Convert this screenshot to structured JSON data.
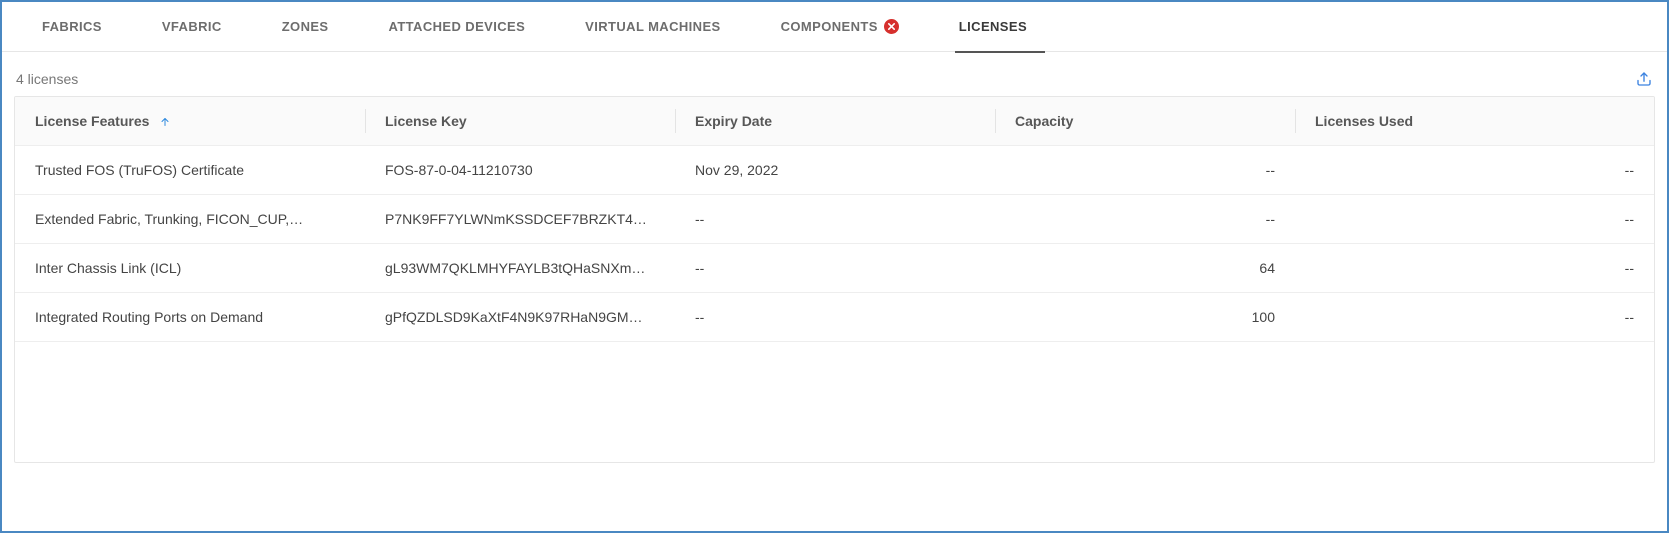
{
  "tabs": [
    {
      "label": "FABRICS",
      "selected": false,
      "status": null
    },
    {
      "label": "VFABRIC",
      "selected": false,
      "status": null
    },
    {
      "label": "ZONES",
      "selected": false,
      "status": null
    },
    {
      "label": "ATTACHED DEVICES",
      "selected": false,
      "status": null
    },
    {
      "label": "VIRTUAL MACHINES",
      "selected": false,
      "status": null
    },
    {
      "label": "COMPONENTS",
      "selected": false,
      "status": "error"
    },
    {
      "label": "LICENSES",
      "selected": true,
      "status": null
    }
  ],
  "summary": "4 licenses",
  "columns": {
    "features": "License Features",
    "key": "License Key",
    "expiry": "Expiry Date",
    "capacity": "Capacity",
    "used": "Licenses Used"
  },
  "sort": {
    "column": "features",
    "dir": "asc"
  },
  "rows": [
    {
      "features": "Trusted FOS (TruFOS) Certificate",
      "key": "FOS-87-0-04-11210730",
      "expiry": "Nov 29, 2022",
      "capacity": "--",
      "used": "--"
    },
    {
      "features": "Extended Fabric, Trunking, FICON_CUP,…",
      "key": "P7NK9FF7YLWNmKSSDCEF7BRZKT4…",
      "expiry": "--",
      "capacity": "--",
      "used": "--"
    },
    {
      "features": "Inter Chassis Link (ICL)",
      "key": "gL93WM7QKLMHYFAYLB3tQHaSNXm…",
      "expiry": "--",
      "capacity": "64",
      "used": "--"
    },
    {
      "features": "Integrated Routing Ports on Demand",
      "key": "gPfQZDLSD9KaXtF4N9K97RHaN9GM…",
      "expiry": "--",
      "capacity": "100",
      "used": "--"
    }
  ]
}
